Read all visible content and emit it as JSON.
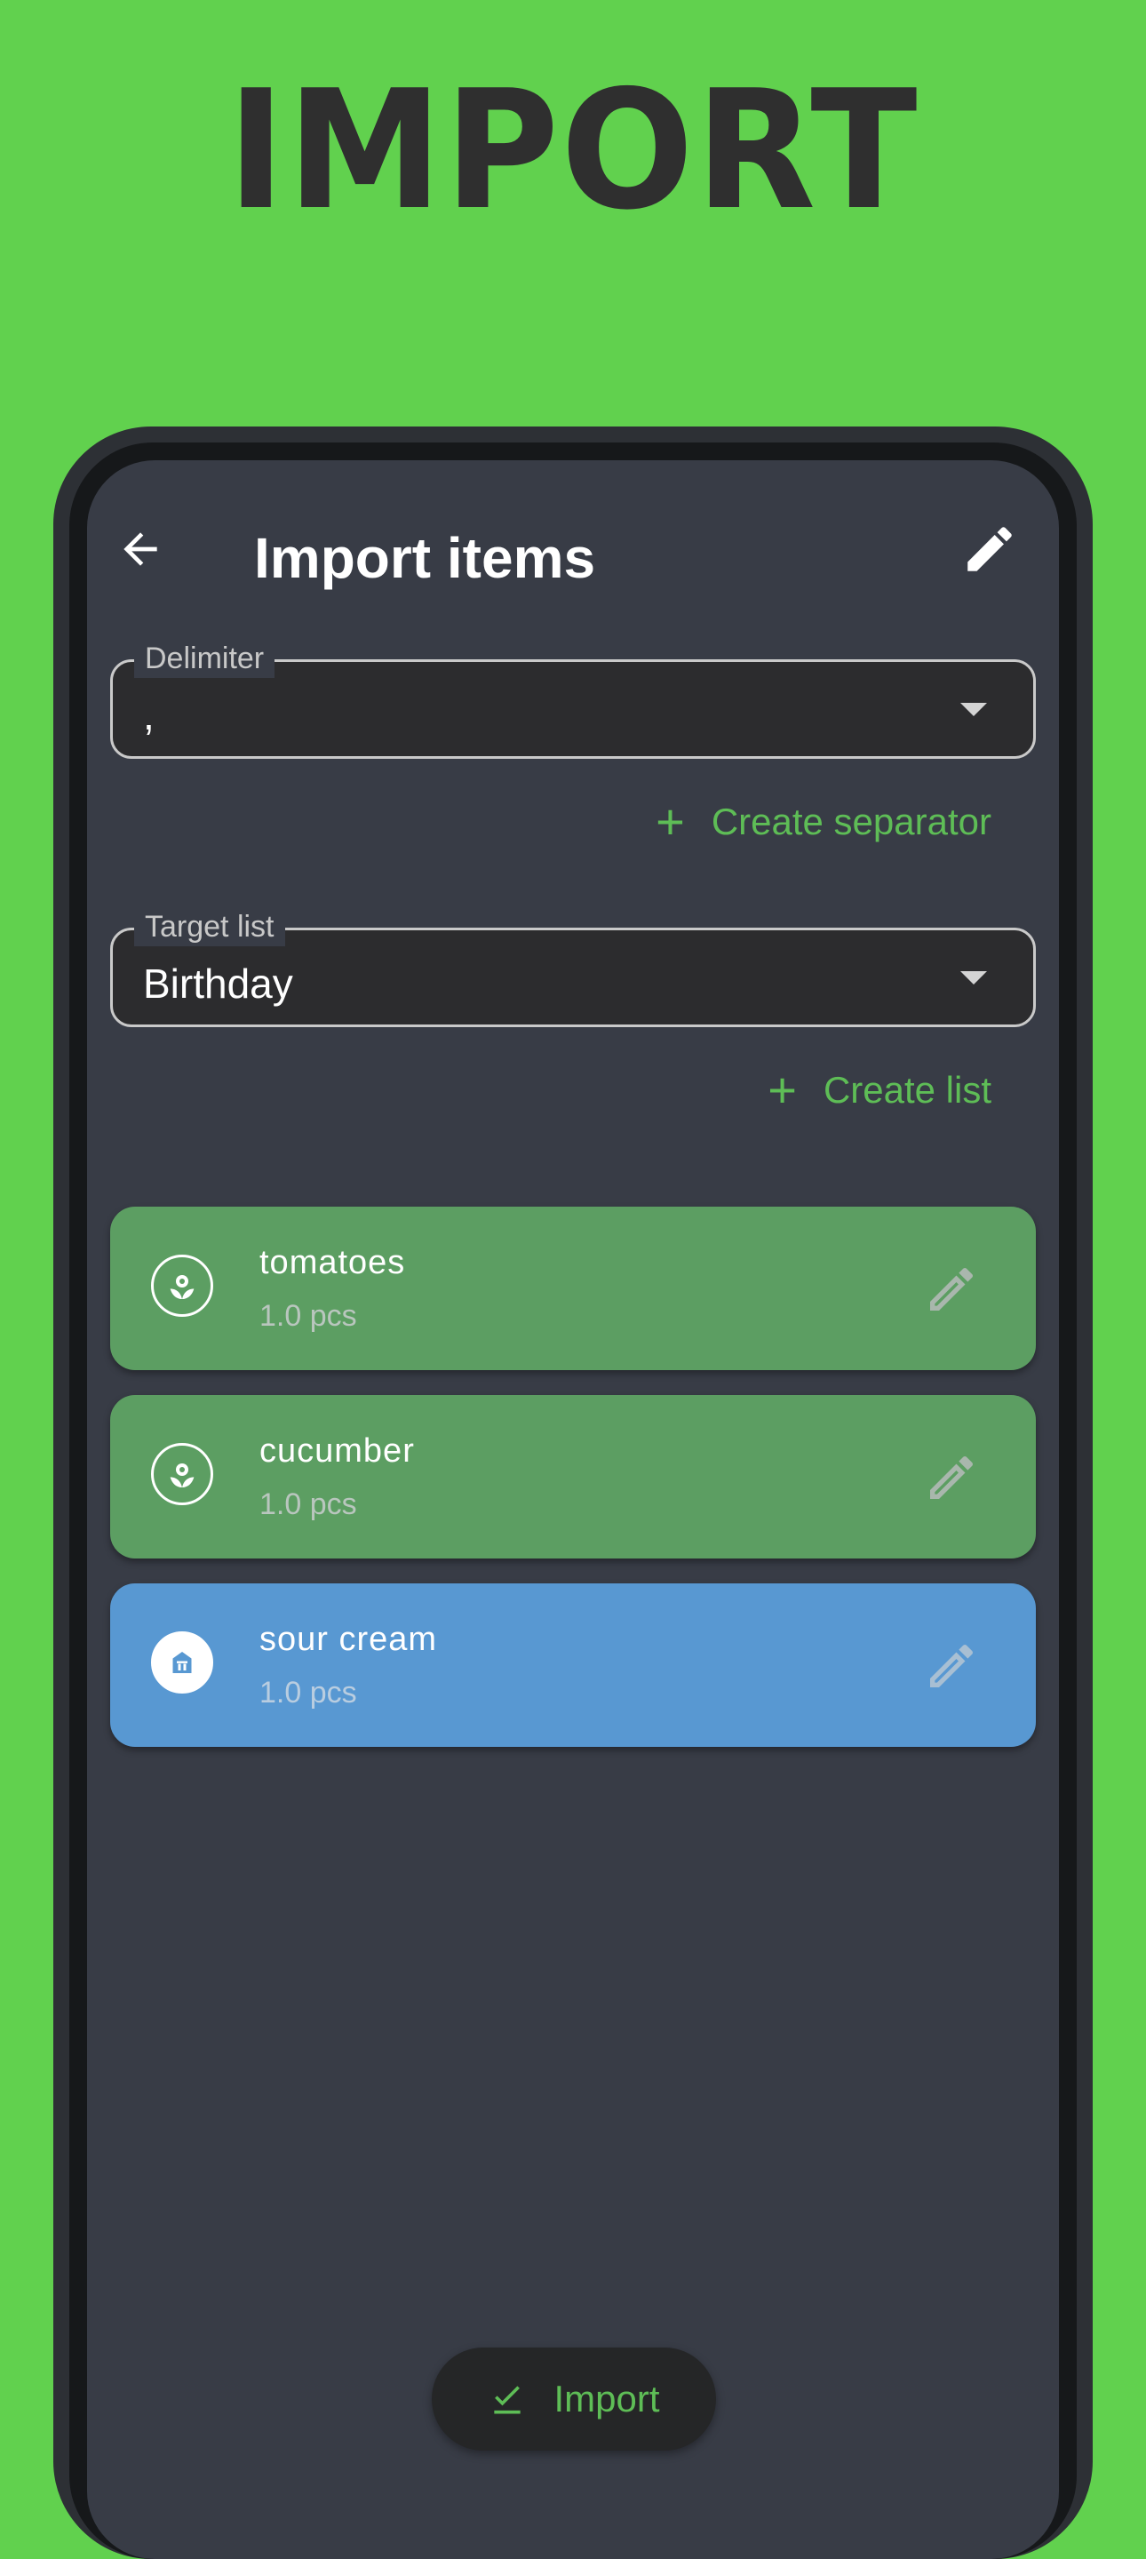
{
  "promo": {
    "title": "IMPORT"
  },
  "appbar": {
    "title": "Import items"
  },
  "delimiter": {
    "label": "Delimiter",
    "value": ","
  },
  "create_separator": {
    "label": "Create separator"
  },
  "target_list": {
    "label": "Target list",
    "value": "Birthday"
  },
  "create_list": {
    "label": "Create list"
  },
  "items": [
    {
      "name": "tomatoes",
      "quantity": "1.0 pcs",
      "color": "#5c9e62",
      "icon": "vegetable-icon"
    },
    {
      "name": "cucumber",
      "quantity": "1.0 pcs",
      "color": "#5c9e62",
      "icon": "vegetable-icon"
    },
    {
      "name": "sour cream",
      "quantity": "1.0 pcs",
      "color": "#5898d2",
      "icon": "dairy-icon"
    }
  ],
  "fab": {
    "label": "Import"
  },
  "colors": {
    "background": "#61d14e",
    "screen": "#383c46",
    "accent": "#5ebd56",
    "green_item": "#5c9e62",
    "blue_item": "#5898d2"
  }
}
